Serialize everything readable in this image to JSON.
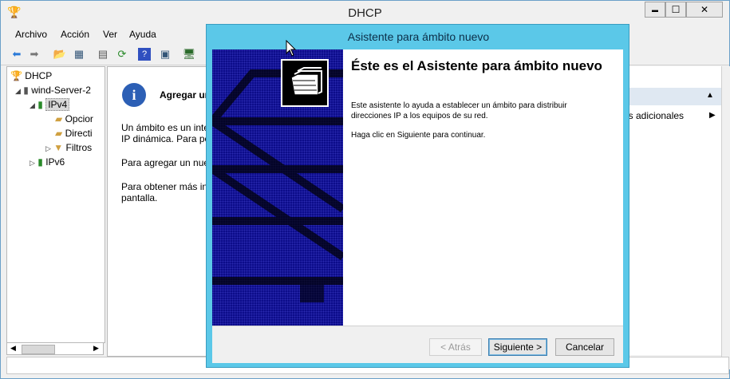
{
  "window": {
    "title": "DHCP",
    "minimize": "▬",
    "maximize": "☐",
    "close": "✕"
  },
  "menu": [
    "Archivo",
    "Acción",
    "Ver",
    "Ayuda"
  ],
  "tree": {
    "root": "DHCP",
    "server": "wind-Server-2",
    "ipv4": "IPv4",
    "opciones": "Opcior",
    "directivas": "Directi",
    "filtros": "Filtros",
    "ipv6": "IPv6"
  },
  "content": {
    "heading": "Agregar un",
    "p1": "Un ámbito es un inte",
    "p1b": "IP dinámica. Para po",
    "p2": "Para agregar un nue",
    "p3": "Para obtener más inf",
    "p3b": "pantalla."
  },
  "actions": {
    "more": "es adicionales"
  },
  "dialog": {
    "title": "Asistente para ámbito nuevo",
    "heading": "Éste es el Asistente para ámbito nuevo",
    "p1": "Este asistente lo ayuda a establecer un ámbito para distribuir direcciones IP a los equipos de su red.",
    "p2": "Haga clic en Siguiente para continuar.",
    "back": "< Atrás",
    "next": "Siguiente >",
    "cancel": "Cancelar"
  },
  "colors": {
    "dialog_frame": "#5bc8e8",
    "banner": "#0c0c8a"
  }
}
